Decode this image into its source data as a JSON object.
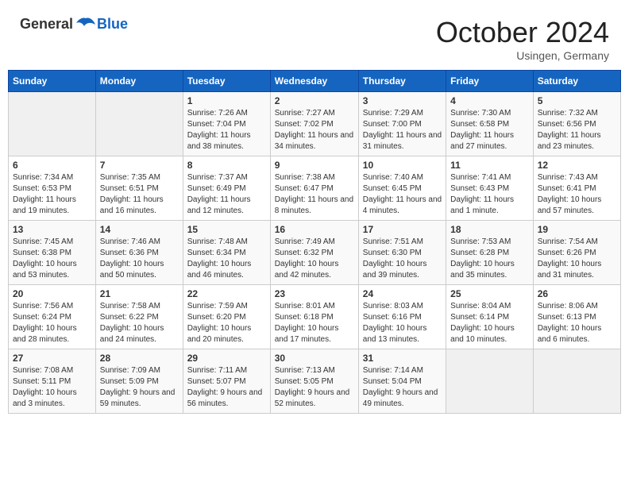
{
  "header": {
    "logo_general": "General",
    "logo_blue": "Blue",
    "month_title": "October 2024",
    "location": "Usingen, Germany"
  },
  "weekdays": [
    "Sunday",
    "Monday",
    "Tuesday",
    "Wednesday",
    "Thursday",
    "Friday",
    "Saturday"
  ],
  "weeks": [
    [
      {
        "day": "",
        "empty": true
      },
      {
        "day": "",
        "empty": true
      },
      {
        "day": "1",
        "sunrise": "Sunrise: 7:26 AM",
        "sunset": "Sunset: 7:04 PM",
        "daylight": "Daylight: 11 hours and 38 minutes."
      },
      {
        "day": "2",
        "sunrise": "Sunrise: 7:27 AM",
        "sunset": "Sunset: 7:02 PM",
        "daylight": "Daylight: 11 hours and 34 minutes."
      },
      {
        "day": "3",
        "sunrise": "Sunrise: 7:29 AM",
        "sunset": "Sunset: 7:00 PM",
        "daylight": "Daylight: 11 hours and 31 minutes."
      },
      {
        "day": "4",
        "sunrise": "Sunrise: 7:30 AM",
        "sunset": "Sunset: 6:58 PM",
        "daylight": "Daylight: 11 hours and 27 minutes."
      },
      {
        "day": "5",
        "sunrise": "Sunrise: 7:32 AM",
        "sunset": "Sunset: 6:56 PM",
        "daylight": "Daylight: 11 hours and 23 minutes."
      }
    ],
    [
      {
        "day": "6",
        "sunrise": "Sunrise: 7:34 AM",
        "sunset": "Sunset: 6:53 PM",
        "daylight": "Daylight: 11 hours and 19 minutes."
      },
      {
        "day": "7",
        "sunrise": "Sunrise: 7:35 AM",
        "sunset": "Sunset: 6:51 PM",
        "daylight": "Daylight: 11 hours and 16 minutes."
      },
      {
        "day": "8",
        "sunrise": "Sunrise: 7:37 AM",
        "sunset": "Sunset: 6:49 PM",
        "daylight": "Daylight: 11 hours and 12 minutes."
      },
      {
        "day": "9",
        "sunrise": "Sunrise: 7:38 AM",
        "sunset": "Sunset: 6:47 PM",
        "daylight": "Daylight: 11 hours and 8 minutes."
      },
      {
        "day": "10",
        "sunrise": "Sunrise: 7:40 AM",
        "sunset": "Sunset: 6:45 PM",
        "daylight": "Daylight: 11 hours and 4 minutes."
      },
      {
        "day": "11",
        "sunrise": "Sunrise: 7:41 AM",
        "sunset": "Sunset: 6:43 PM",
        "daylight": "Daylight: 11 hours and 1 minute."
      },
      {
        "day": "12",
        "sunrise": "Sunrise: 7:43 AM",
        "sunset": "Sunset: 6:41 PM",
        "daylight": "Daylight: 10 hours and 57 minutes."
      }
    ],
    [
      {
        "day": "13",
        "sunrise": "Sunrise: 7:45 AM",
        "sunset": "Sunset: 6:38 PM",
        "daylight": "Daylight: 10 hours and 53 minutes."
      },
      {
        "day": "14",
        "sunrise": "Sunrise: 7:46 AM",
        "sunset": "Sunset: 6:36 PM",
        "daylight": "Daylight: 10 hours and 50 minutes."
      },
      {
        "day": "15",
        "sunrise": "Sunrise: 7:48 AM",
        "sunset": "Sunset: 6:34 PM",
        "daylight": "Daylight: 10 hours and 46 minutes."
      },
      {
        "day": "16",
        "sunrise": "Sunrise: 7:49 AM",
        "sunset": "Sunset: 6:32 PM",
        "daylight": "Daylight: 10 hours and 42 minutes."
      },
      {
        "day": "17",
        "sunrise": "Sunrise: 7:51 AM",
        "sunset": "Sunset: 6:30 PM",
        "daylight": "Daylight: 10 hours and 39 minutes."
      },
      {
        "day": "18",
        "sunrise": "Sunrise: 7:53 AM",
        "sunset": "Sunset: 6:28 PM",
        "daylight": "Daylight: 10 hours and 35 minutes."
      },
      {
        "day": "19",
        "sunrise": "Sunrise: 7:54 AM",
        "sunset": "Sunset: 6:26 PM",
        "daylight": "Daylight: 10 hours and 31 minutes."
      }
    ],
    [
      {
        "day": "20",
        "sunrise": "Sunrise: 7:56 AM",
        "sunset": "Sunset: 6:24 PM",
        "daylight": "Daylight: 10 hours and 28 minutes."
      },
      {
        "day": "21",
        "sunrise": "Sunrise: 7:58 AM",
        "sunset": "Sunset: 6:22 PM",
        "daylight": "Daylight: 10 hours and 24 minutes."
      },
      {
        "day": "22",
        "sunrise": "Sunrise: 7:59 AM",
        "sunset": "Sunset: 6:20 PM",
        "daylight": "Daylight: 10 hours and 20 minutes."
      },
      {
        "day": "23",
        "sunrise": "Sunrise: 8:01 AM",
        "sunset": "Sunset: 6:18 PM",
        "daylight": "Daylight: 10 hours and 17 minutes."
      },
      {
        "day": "24",
        "sunrise": "Sunrise: 8:03 AM",
        "sunset": "Sunset: 6:16 PM",
        "daylight": "Daylight: 10 hours and 13 minutes."
      },
      {
        "day": "25",
        "sunrise": "Sunrise: 8:04 AM",
        "sunset": "Sunset: 6:14 PM",
        "daylight": "Daylight: 10 hours and 10 minutes."
      },
      {
        "day": "26",
        "sunrise": "Sunrise: 8:06 AM",
        "sunset": "Sunset: 6:13 PM",
        "daylight": "Daylight: 10 hours and 6 minutes."
      }
    ],
    [
      {
        "day": "27",
        "sunrise": "Sunrise: 7:08 AM",
        "sunset": "Sunset: 5:11 PM",
        "daylight": "Daylight: 10 hours and 3 minutes."
      },
      {
        "day": "28",
        "sunrise": "Sunrise: 7:09 AM",
        "sunset": "Sunset: 5:09 PM",
        "daylight": "Daylight: 9 hours and 59 minutes."
      },
      {
        "day": "29",
        "sunrise": "Sunrise: 7:11 AM",
        "sunset": "Sunset: 5:07 PM",
        "daylight": "Daylight: 9 hours and 56 minutes."
      },
      {
        "day": "30",
        "sunrise": "Sunrise: 7:13 AM",
        "sunset": "Sunset: 5:05 PM",
        "daylight": "Daylight: 9 hours and 52 minutes."
      },
      {
        "day": "31",
        "sunrise": "Sunrise: 7:14 AM",
        "sunset": "Sunset: 5:04 PM",
        "daylight": "Daylight: 9 hours and 49 minutes."
      },
      {
        "day": "",
        "empty": true
      },
      {
        "day": "",
        "empty": true
      }
    ]
  ]
}
